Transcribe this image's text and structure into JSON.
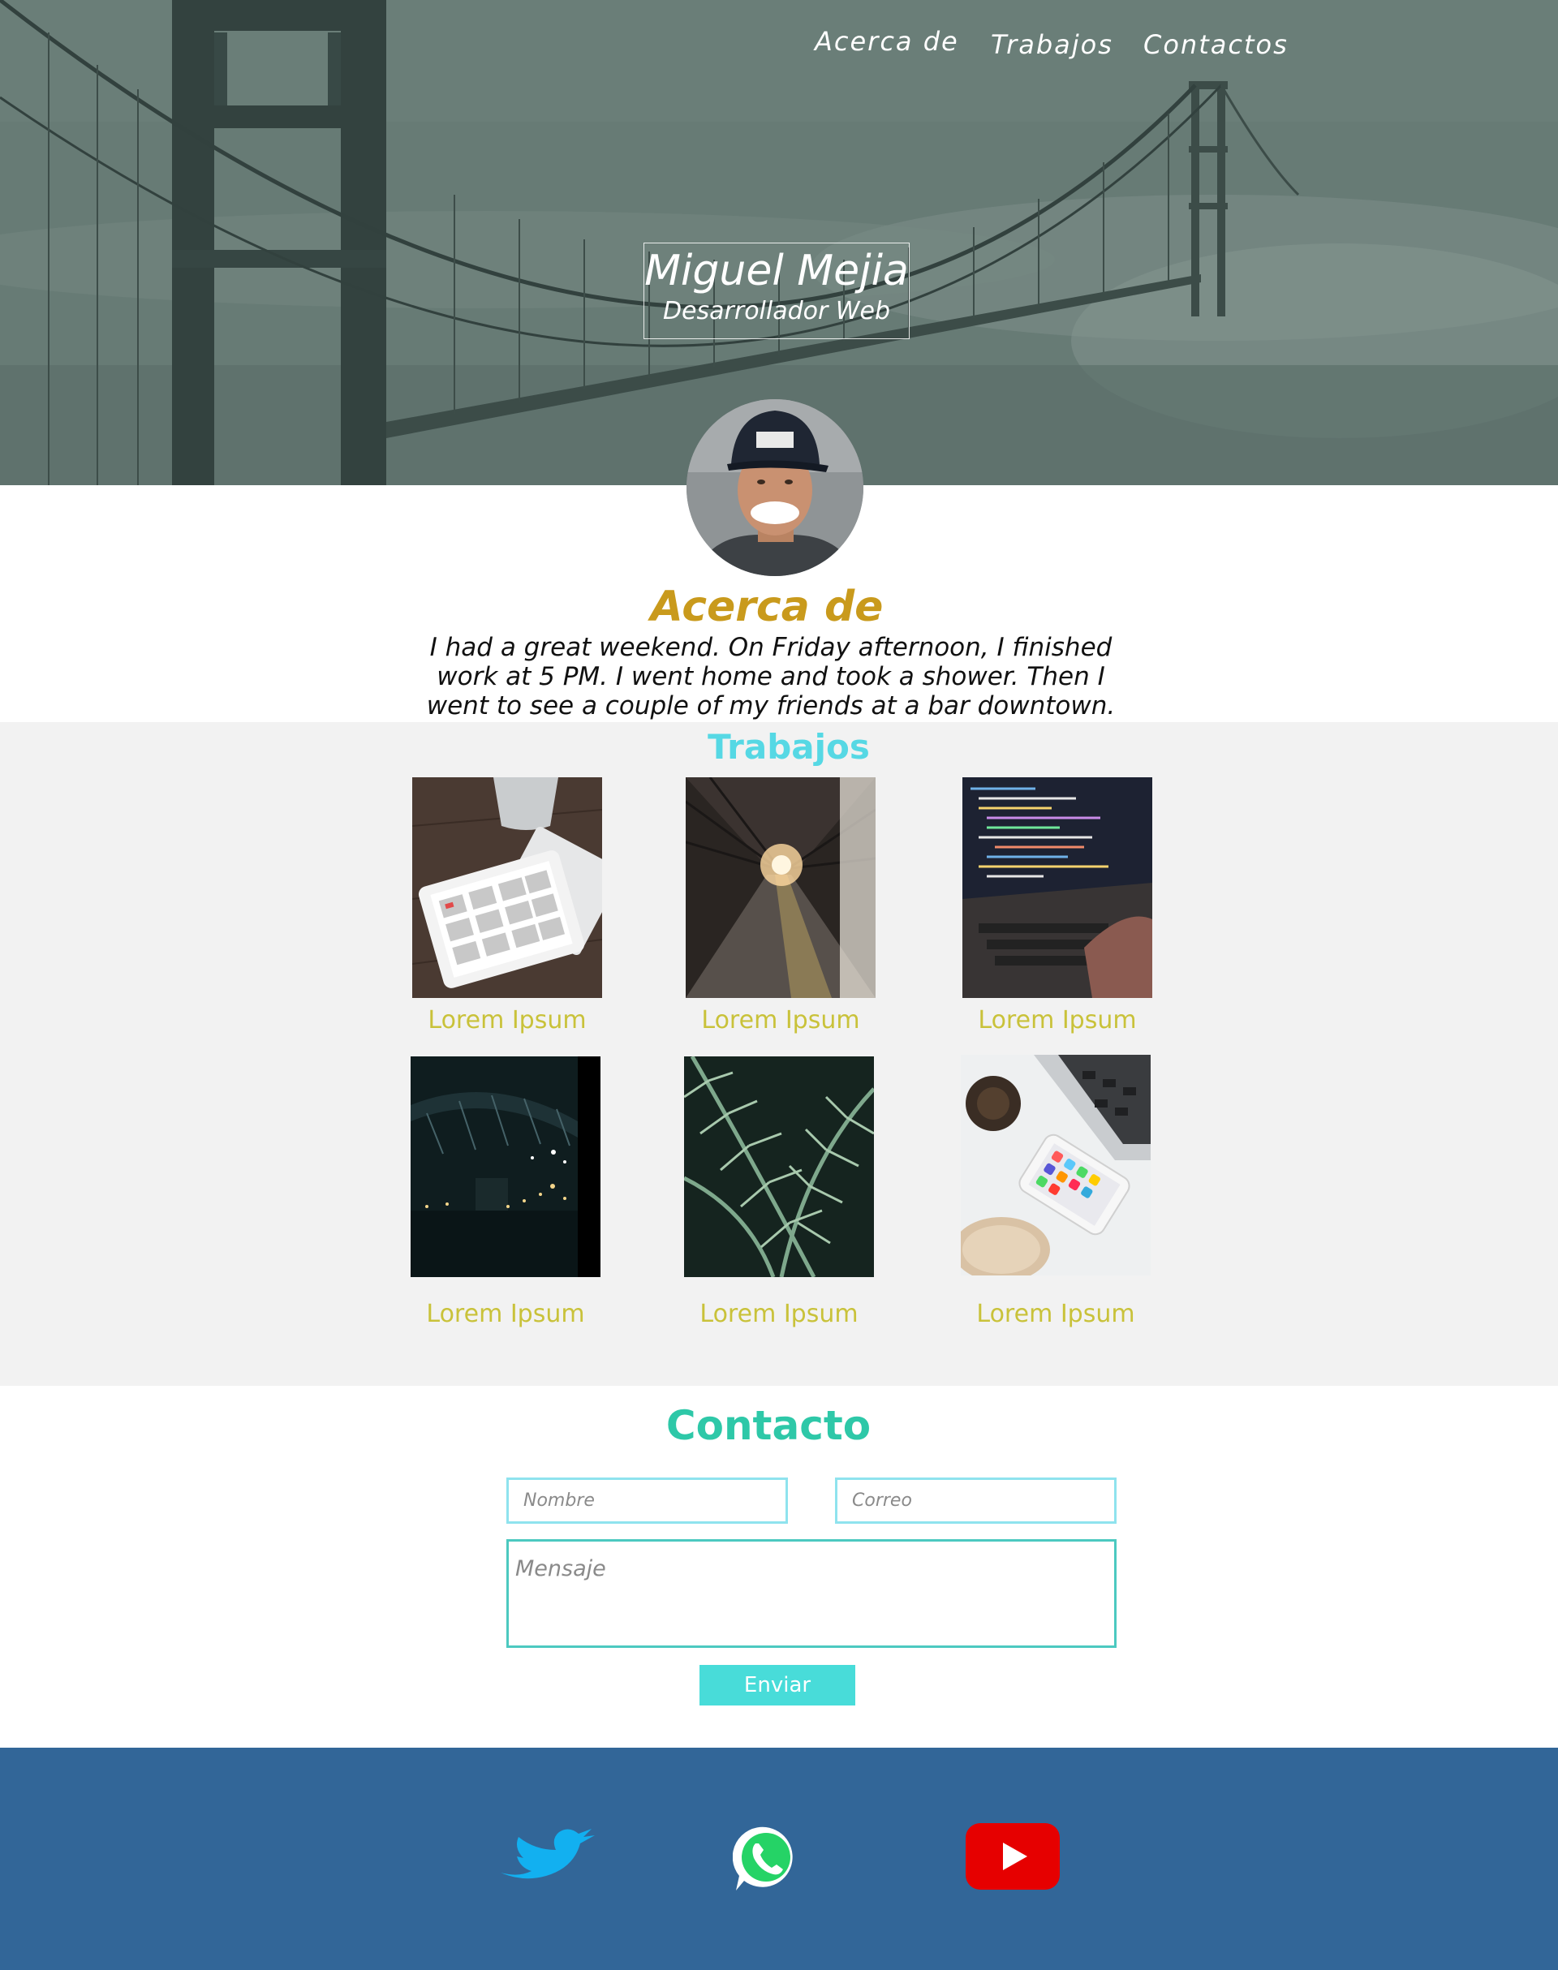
{
  "nav": {
    "items": [
      {
        "label": "Acerca de"
      },
      {
        "label": "Trabajos"
      },
      {
        "label": "Contactos"
      }
    ]
  },
  "hero": {
    "name": "Miguel Mejia",
    "role": "Desarrollador Web"
  },
  "about": {
    "title": "Acerca de",
    "text": "I had a great weekend. On Friday afternoon, I finished work at 5 PM. I went home and took a shower. Then I went to see a couple of my friends at a bar downtown."
  },
  "works": {
    "title": "Trabajos",
    "items": [
      {
        "caption": "Lorem Ipsum",
        "image": "tablet-keyboard-desk"
      },
      {
        "caption": "Lorem Ipsum",
        "image": "train-station-sunset"
      },
      {
        "caption": "Lorem Ipsum",
        "image": "laptop-code"
      },
      {
        "caption": "Lorem Ipsum",
        "image": "bridge-night"
      },
      {
        "caption": "Lorem Ipsum",
        "image": "fern-leaves"
      },
      {
        "caption": "Lorem Ipsum",
        "image": "laptop-phone-desk"
      }
    ]
  },
  "contact": {
    "title": "Contacto",
    "name_placeholder": "Nombre",
    "email_placeholder": "Correo",
    "message_placeholder": "Mensaje",
    "submit_label": "Enviar"
  },
  "footer": {
    "social": [
      {
        "icon": "twitter-icon",
        "color": "#1da1f2"
      },
      {
        "icon": "whatsapp-icon",
        "color": "#25d366"
      },
      {
        "icon": "youtube-icon",
        "color": "#e00000"
      }
    ],
    "background": "#326698"
  },
  "colors": {
    "accent_gold": "#c99a1c",
    "accent_cyan": "#56d8e4",
    "accent_green": "#2ec8a8",
    "caption": "#c9c23a",
    "button": "#48dcd9"
  }
}
